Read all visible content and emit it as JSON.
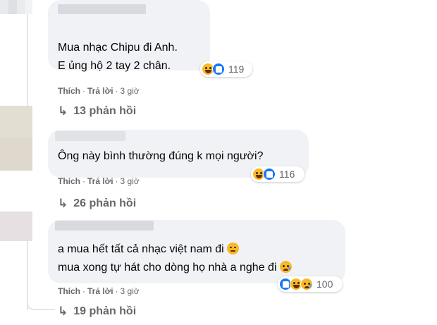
{
  "comments": [
    {
      "text_lines": [
        "Mua nhạc Chipu đi Anh.",
        "E ủng hộ 2 tay 2 chân."
      ],
      "reaction_icons": [
        "haha-icon",
        "like-icon"
      ],
      "reaction_count": "119",
      "like_label": "Thích",
      "reply_label": "Trả lời",
      "time": "3 giờ",
      "replies_label": "13 phản hồi"
    },
    {
      "text_lines": [
        "Ông này bình thường đúng k mọi người?"
      ],
      "reaction_icons": [
        "haha-icon",
        "like-icon"
      ],
      "reaction_count": "116",
      "like_label": "Thích",
      "reply_label": "Trả lời",
      "time": "3 giờ",
      "replies_label": "26 phản hồi"
    },
    {
      "text_lines": [
        "a mua hết tất cả nhạc việt nam đi",
        "mua xong tự hát cho dòng họ nhà a nghe đi"
      ],
      "inline_emojis": [
        "disappointed-face-icon",
        "sad-tear-face-icon"
      ],
      "reaction_icons": [
        "like-icon",
        "haha-icon",
        "sad-icon"
      ],
      "reaction_count": "100",
      "like_label": "Thích",
      "reply_label": "Trả lời",
      "time": "3 giờ",
      "replies_label": "19 phản hồi"
    }
  ],
  "colors": {
    "bubble": "#f0f2f5",
    "meta_text": "#65676b",
    "like_blue": "#1877f2",
    "emoji_yellow": "#f7b928"
  }
}
